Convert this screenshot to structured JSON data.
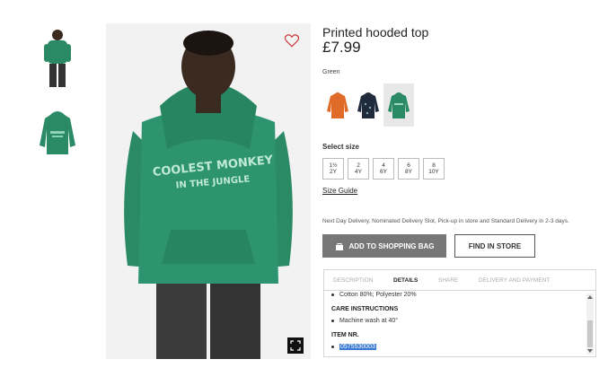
{
  "product": {
    "title": "Printed hooded top",
    "price": "£7.99",
    "color_name": "Green",
    "hoodie_print_line1": "COOLEST MONKEY",
    "hoodie_print_line2": "IN THE JUNGLE"
  },
  "swatches": [
    {
      "name": "orange",
      "color": "#e06a27"
    },
    {
      "name": "navy",
      "color": "#1f2a3c"
    },
    {
      "name": "green",
      "color": "#2a8a66"
    }
  ],
  "size": {
    "label": "Select size",
    "options": [
      {
        "top": "1½",
        "bottom": "2Y"
      },
      {
        "top": "2",
        "bottom": "4Y"
      },
      {
        "top": "4",
        "bottom": "6Y"
      },
      {
        "top": "6",
        "bottom": "8Y"
      },
      {
        "top": "8",
        "bottom": "10Y"
      }
    ],
    "guide_label": "Size Guide"
  },
  "delivery_text": "Next Day Delivery, Nominated Delivery Slot, Pick-up in store and Standard Delivery in 2-3 days.",
  "actions": {
    "add_to_bag": "ADD TO SHOPPING BAG",
    "find_in_store": "FIND IN STORE"
  },
  "tabs": {
    "items": [
      "DESCRIPTION",
      "DETAILS",
      "SHARE",
      "DELIVERY AND PAYMENT"
    ],
    "active": "DETAILS"
  },
  "details": {
    "composition": "Cotton 80%; Polyester 20%",
    "care_heading": "CARE INSTRUCTIONS",
    "care": "Machine wash at 40°",
    "item_heading": "ITEM NR.",
    "item_number": "0575530003"
  },
  "colors": {
    "hoodie_green": "#2a8a66",
    "button_grey": "#777777",
    "selection_blue": "#3b7bd4"
  }
}
